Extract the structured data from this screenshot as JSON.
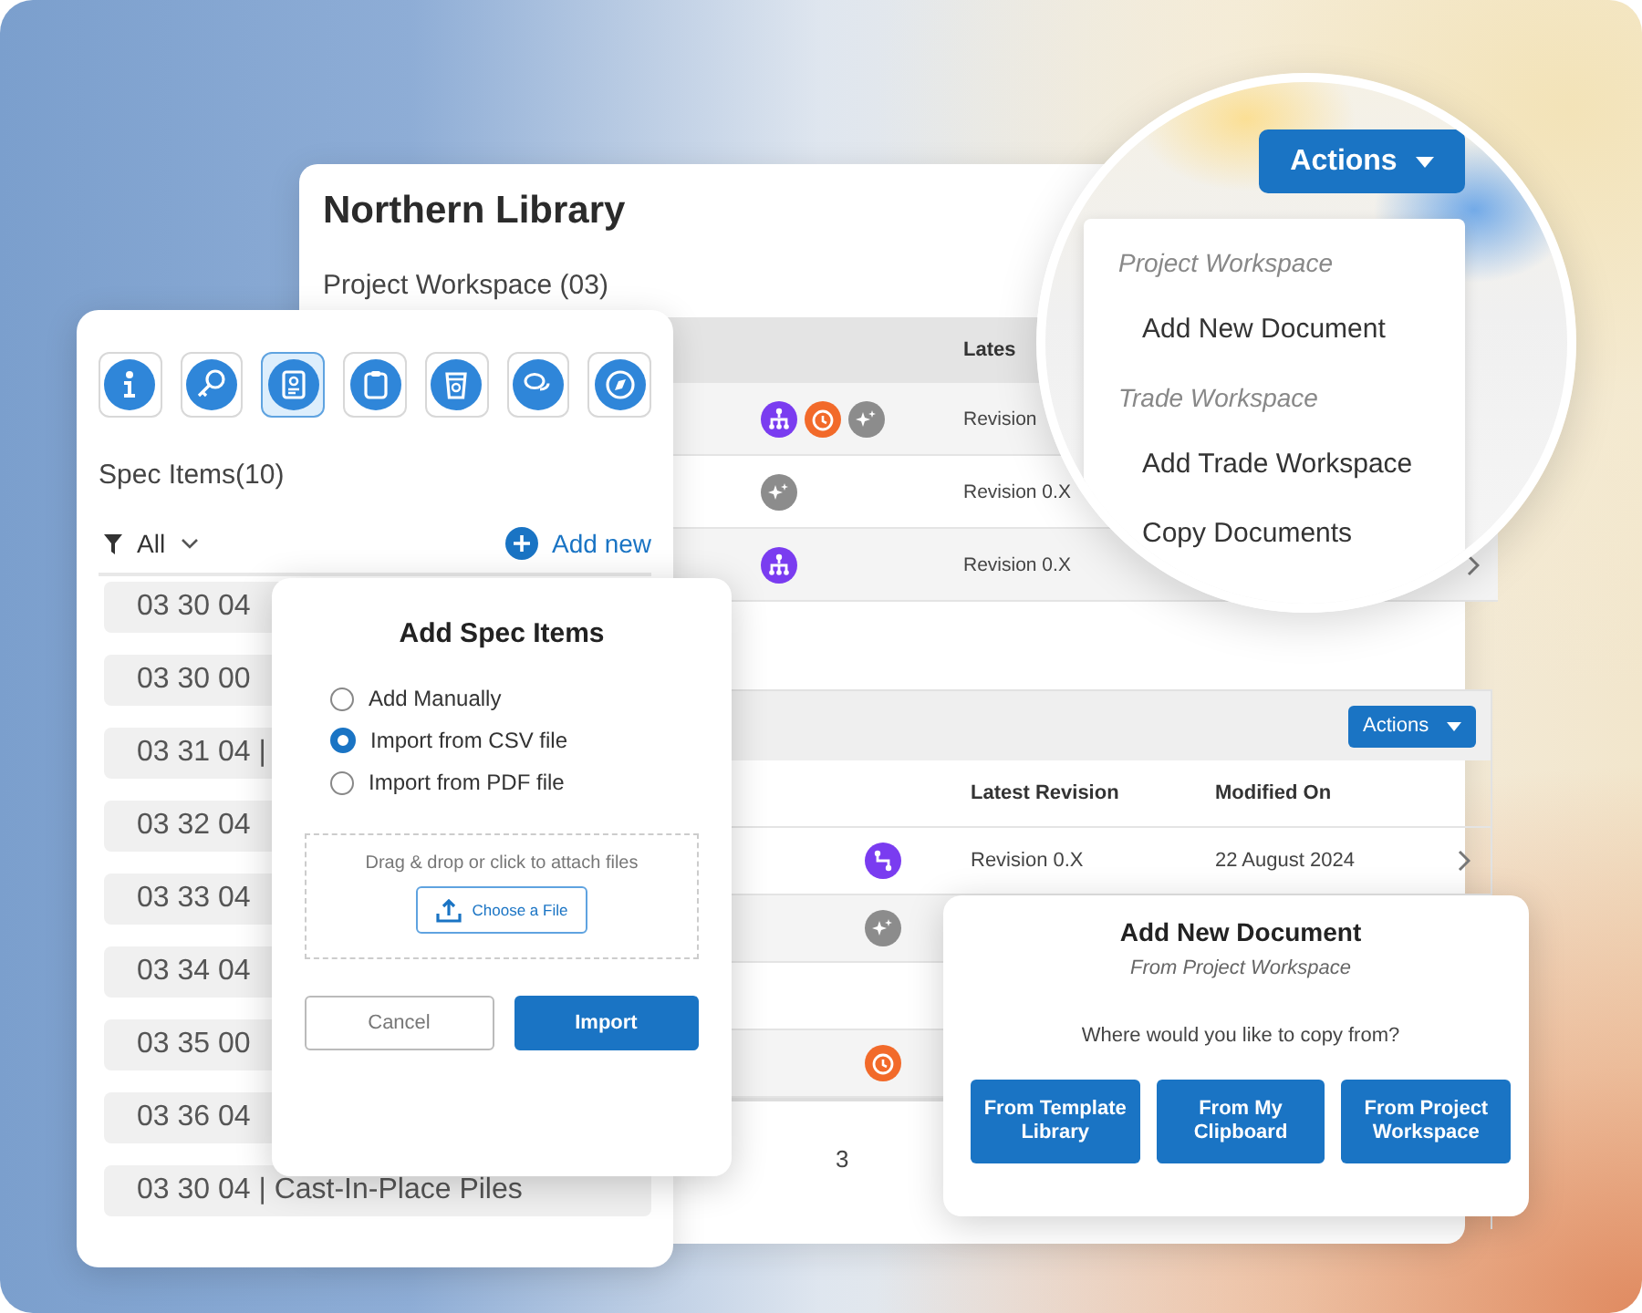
{
  "main": {
    "title": "Northern Library",
    "subtitle": "Project Workspace (03)",
    "table": {
      "columns": [
        "Lates"
      ],
      "rows": [
        {
          "icons": [
            {
              "kind": "hierarchy"
            },
            {
              "kind": "history"
            },
            {
              "kind": "sparkle"
            }
          ],
          "revision": "Revision",
          "chevron": false
        },
        {
          "icons": [
            {
              "kind": "sparkle"
            }
          ],
          "revision": "Revision 0.X",
          "chevron": false
        },
        {
          "icons": [
            {
              "kind": "hierarchy"
            }
          ],
          "revision": "Revision 0.X",
          "chevron": true
        }
      ]
    },
    "section": {
      "actions": "Actions",
      "columns": [
        "Latest Revision",
        "Modified On"
      ],
      "rows": [
        {
          "icons": [
            {
              "kind": "branch"
            }
          ],
          "revision": "Revision 0.X",
          "modified": "22 August 2024",
          "chevron": true
        },
        {
          "icons": [
            {
              "kind": "sparkle"
            }
          ],
          "chevron": false
        },
        {
          "chevron": false
        },
        {
          "icons": [
            {
              "kind": "history"
            }
          ],
          "chevron": false
        }
      ]
    },
    "footer": "3"
  },
  "magnifier": {
    "actions": "Actions",
    "groups": [
      {
        "heading": "Project Workspace",
        "items": [
          "Add New Document"
        ]
      },
      {
        "heading": "Trade Workspace",
        "items": [
          "Add Trade Workspace",
          "Copy Documents"
        ]
      }
    ]
  },
  "spec_panel": {
    "tools": [
      {
        "kind": "info",
        "selected": false
      },
      {
        "kind": "key",
        "selected": false
      },
      {
        "kind": "card",
        "selected": true
      },
      {
        "kind": "clipboard",
        "selected": false
      },
      {
        "kind": "bin",
        "selected": false
      },
      {
        "kind": "chat",
        "selected": false
      },
      {
        "kind": "compass",
        "selected": false
      }
    ],
    "title": "Spec Items(10)",
    "filter": "All",
    "add_new": "Add new",
    "items": [
      "03 30 04",
      "03 30 00",
      "03 31 04 |",
      "03 32 04",
      "03 33 04",
      "03 34 04",
      "03 35 00",
      "03 36 04",
      "03 30 04 | Cast-In-Place Piles"
    ]
  },
  "spec_modal": {
    "title": "Add Spec Items",
    "options": [
      {
        "label": "Add Manually",
        "selected": false
      },
      {
        "label": "Import from CSV file",
        "selected": true
      },
      {
        "label": "Import from PDF file",
        "selected": false
      }
    ],
    "drop_hint": "Drag & drop or click to attach files",
    "choose": "Choose a File",
    "buttons": [
      {
        "label": "Cancel",
        "kind": "secondary"
      },
      {
        "label": "Import",
        "kind": "primary"
      }
    ]
  },
  "doc_modal": {
    "title": "Add New Document",
    "subtitle": "From Project Workspace",
    "question": "Where would you like to copy from?",
    "buttons": [
      "From Template Library",
      "From My Clipboard",
      "From Project Workspace"
    ]
  }
}
